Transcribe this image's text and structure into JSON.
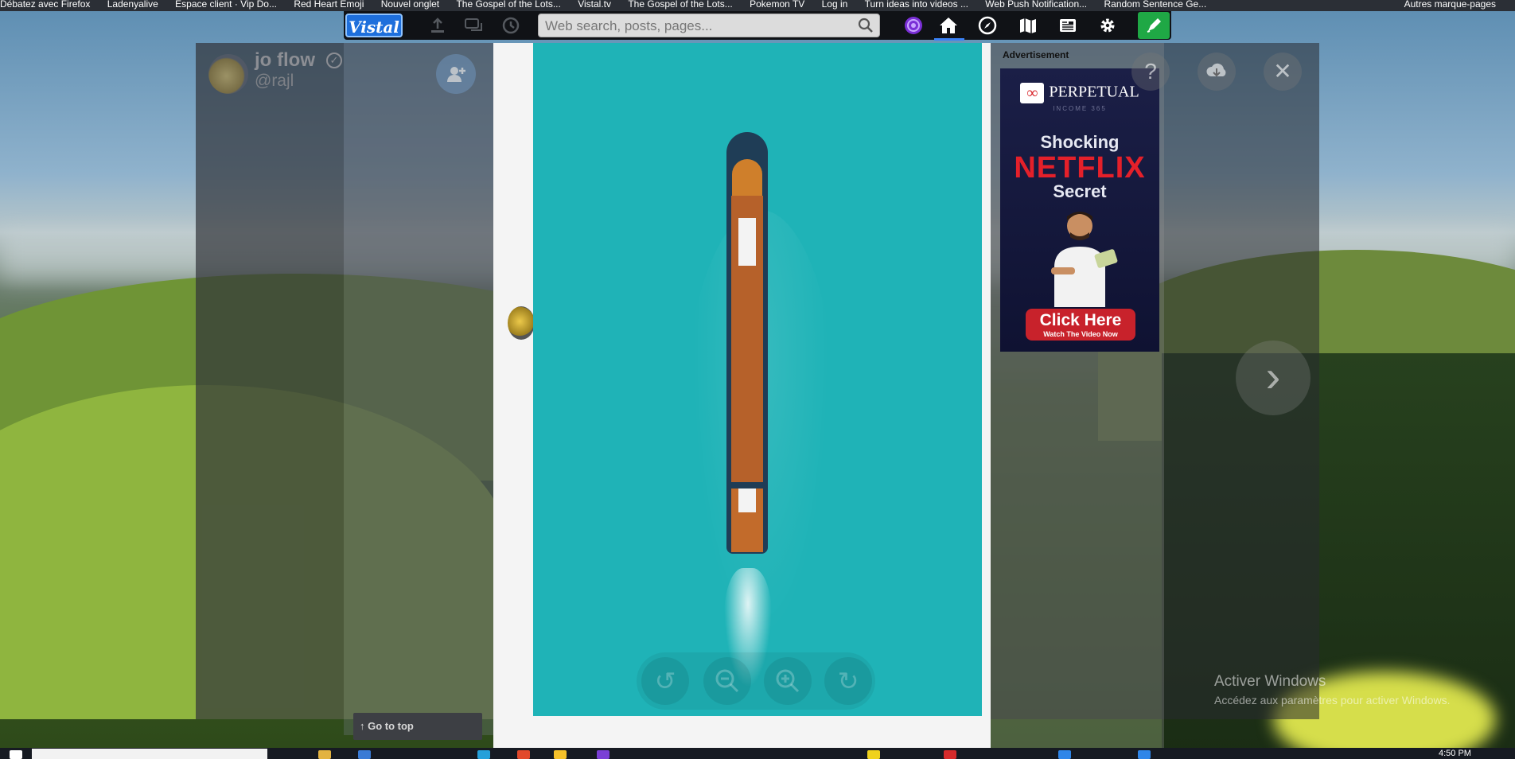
{
  "browser": {
    "bookmarks": [
      "Débatez avec Firefox",
      "Ladenyalive",
      "Espace client · Vip Do...",
      "Red Heart Emoji",
      "Nouvel onglet",
      "The Gospel of the Lots...",
      "Vistal.tv",
      "The Gospel of the Lots...",
      "Pokemon TV",
      "Log in",
      "Turn ideas into videos ...",
      "Web Push Notification...",
      "Random Sentence Ge..."
    ],
    "bookmarks_more": "Autres marque-pages"
  },
  "nav": {
    "logo": "Vistal",
    "search_placeholder": "Web search, posts, pages...",
    "icons": [
      "upload-icon",
      "chat-icon",
      "history-icon",
      "vortex-icon",
      "home-icon",
      "compass-icon",
      "map-icon",
      "news-icon",
      "gear-icon",
      "compose-icon"
    ]
  },
  "profile": {
    "name": "jo flow",
    "handle": "@rajl"
  },
  "viewer": {
    "image_subject": "ship-aerial-photo",
    "zoom_controls": [
      "rotate-left-icon",
      "zoom-out-icon",
      "zoom-in-icon",
      "rotate-right-icon"
    ],
    "go_to_top": "↑ Go to top"
  },
  "ad": {
    "label": "Advertisement",
    "brand": "PERPETUAL",
    "brand_sub": "INCOME 365",
    "line1": "Shocking",
    "line2": "NETFLIX",
    "line3": "Secret",
    "cta": "Click Here",
    "cta_sub": "Watch The Video Now"
  },
  "windows": {
    "activate_title": "Activer Windows",
    "activate_sub": "Accédez aux paramètres pour activer Windows.",
    "clock": "4:50 PM"
  },
  "colors": {
    "accent": "#1e6fdc",
    "compose": "#1fa845",
    "photo_water": "#1fb3b7",
    "ad_red": "#e4202a"
  }
}
